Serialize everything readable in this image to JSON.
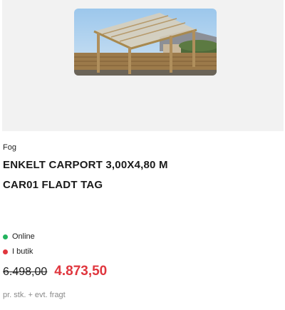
{
  "product": {
    "brand": "Fog",
    "title_line_1": "ENKELT CARPORT 3,00X4,80 M",
    "title_line_2": "CAR01 FLADT TAG",
    "image_icon": "carport-photo"
  },
  "stock": {
    "online_label": "Online",
    "online_color": "#22b35e",
    "store_label": "I butik",
    "store_color": "#e0363e"
  },
  "pricing": {
    "old_price": "6.498,00",
    "new_price": "4.873,50",
    "note": "pr. stk. + evt. fragt",
    "sale_color": "#e0363e"
  }
}
